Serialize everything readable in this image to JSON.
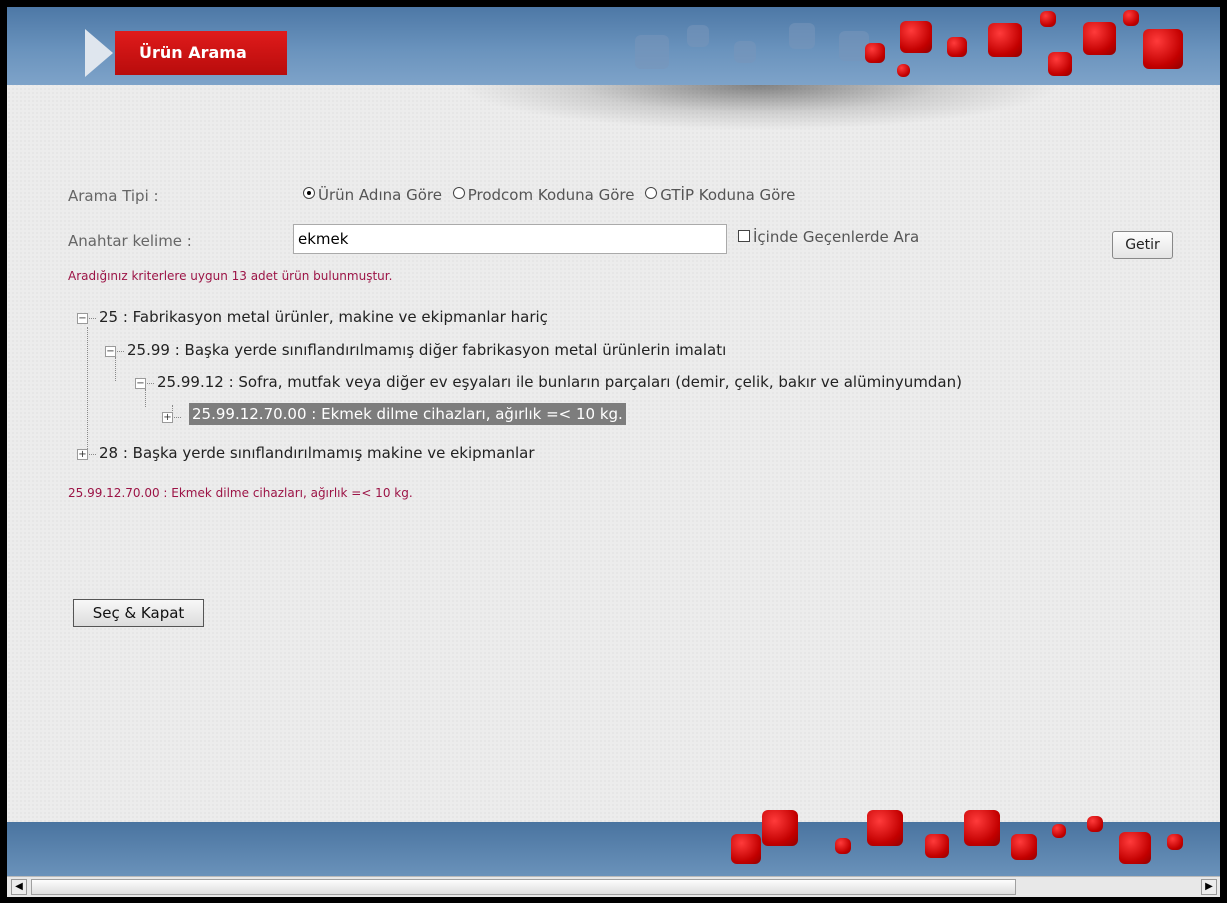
{
  "header": {
    "tab_title": "Ürün Arama"
  },
  "search": {
    "type_label": "Arama Tipi :",
    "radio_options": [
      {
        "label": "Ürün Adına Göre",
        "checked": true
      },
      {
        "label": "Prodcom Koduna Göre",
        "checked": false
      },
      {
        "label": "GTİP Koduna Göre",
        "checked": false
      }
    ],
    "keyword_label": "Anahtar kelime :",
    "keyword_value": "ekmek",
    "contains_label": "İçinde Geçenlerde Ara",
    "contains_checked": false,
    "submit_label": "Getir"
  },
  "result_message": "Aradığınız kriterlere uygun 13 adet ürün bulunmuştur.",
  "tree": [
    {
      "text": "25 : Fabrikasyon metal ürünler, makine ve ekipmanlar hariç",
      "state": "expanded"
    },
    {
      "text": "25.99 : Başka yerde sınıflandırılmamış diğer fabrikasyon metal ürünlerin imalatı",
      "state": "expanded"
    },
    {
      "text": "25.99.12 : Sofra, mutfak veya diğer ev eşyaları ile bunların parçaları (demir, çelik, bakır ve alüminyumdan)",
      "state": "expanded"
    },
    {
      "text": "25.99.12.70.00 : Ekmek dilme cihazları, ağırlık =< 10 kg.",
      "state": "collapsed",
      "selected": true
    },
    {
      "text": "28 : Başka yerde sınıflandırılmamış makine ve ekipmanlar",
      "state": "collapsed"
    }
  ],
  "selected_message": "25.99.12.70.00 : Ekmek dilme cihazları, ağırlık =< 10 kg.",
  "select_close_label": "Seç & Kapat",
  "icons": {
    "expanded": "−",
    "collapsed": "+",
    "scroll_left": "◀",
    "scroll_right": "▶"
  },
  "colors": {
    "accent_red": "#d31414",
    "message": "#9c1446",
    "header_blue": "#5b84b1",
    "selection": "#7d7d7d"
  }
}
